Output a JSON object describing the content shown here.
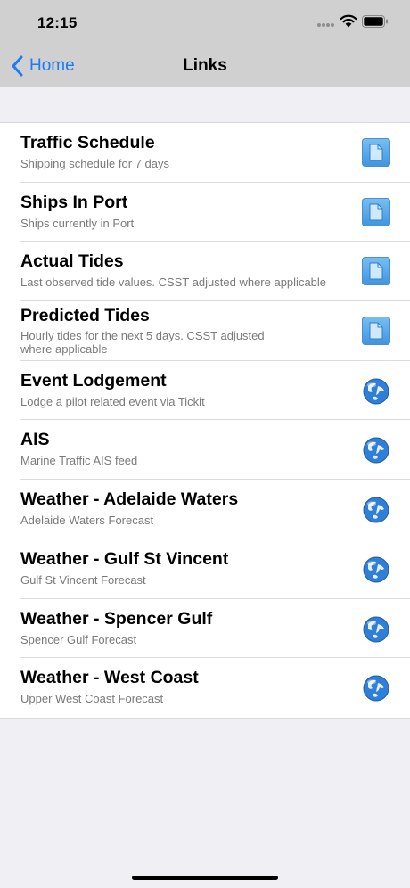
{
  "status_bar": {
    "time": "12:15"
  },
  "nav": {
    "back_label": "Home",
    "title": "Links"
  },
  "links": [
    {
      "title": "Traffic Schedule",
      "subtitle": "Shipping schedule for 7 days",
      "icon": "document-icon"
    },
    {
      "title": "Ships In Port",
      "subtitle": "Ships currently in Port",
      "icon": "document-icon"
    },
    {
      "title": "Actual Tides",
      "subtitle": "Last observed tide values. CSST adjusted where applicable",
      "icon": "document-icon"
    },
    {
      "title": "Predicted Tides",
      "subtitle": "Hourly tides for the next 5 days. CSST adjusted where applicable",
      "icon": "document-icon"
    },
    {
      "title": "Event Lodgement",
      "subtitle": "Lodge a pilot related event via Tickit",
      "icon": "globe-icon"
    },
    {
      "title": "AIS",
      "subtitle": "Marine Traffic AIS feed",
      "icon": "globe-icon"
    },
    {
      "title": "Weather - Adelaide Waters",
      "subtitle": "Adelaide Waters Forecast",
      "icon": "globe-icon"
    },
    {
      "title": "Weather - Gulf St Vincent",
      "subtitle": "Gulf St Vincent Forecast",
      "icon": "globe-icon"
    },
    {
      "title": "Weather - Spencer Gulf",
      "subtitle": "Spencer Gulf Forecast",
      "icon": "globe-icon"
    },
    {
      "title": "Weather - West Coast",
      "subtitle": "Upper West Coast Forecast",
      "icon": "globe-icon"
    }
  ],
  "colors": {
    "accent": "#1a7cf5",
    "bar_background": "#d0d0d0",
    "page_background": "#efeff4"
  }
}
